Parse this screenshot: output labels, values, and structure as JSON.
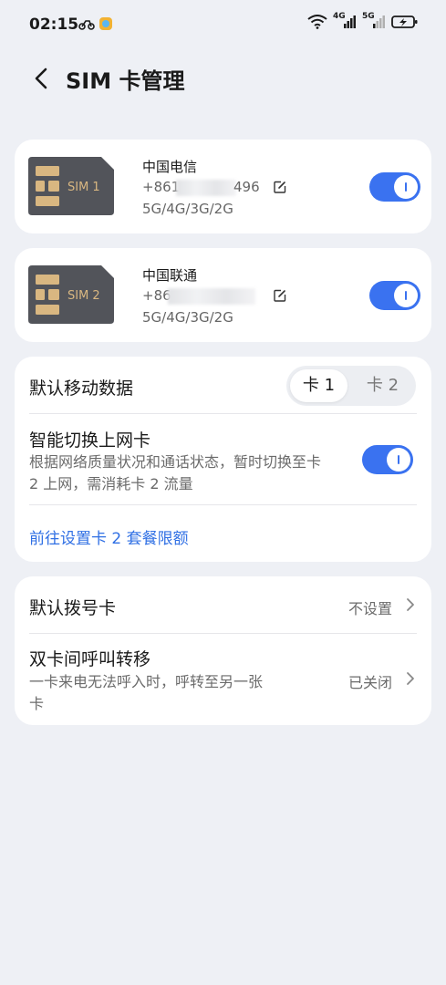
{
  "status_bar": {
    "time": "02:15",
    "net_1": "4G",
    "net_2": "5G"
  },
  "header": {
    "title": "SIM 卡管理"
  },
  "sims": [
    {
      "chip_label": "SIM 1",
      "carrier": "中国电信",
      "number_prefix": "+861",
      "number_suffix": "496",
      "network": "5G/4G/3G/2G",
      "enabled": true
    },
    {
      "chip_label": "SIM 2",
      "carrier": "中国联通",
      "number_prefix": "+86",
      "number_suffix": "",
      "network": "5G/4G/3G/2G",
      "enabled": true
    }
  ],
  "data_card": {
    "default_data_label": "默认移动数据",
    "options": [
      "卡 1",
      "卡 2"
    ],
    "selected": "卡 1",
    "smart_switch_title": "智能切换上网卡",
    "smart_switch_desc": "根据网络质量状况和通话状态，暂时切换至卡 2 上网，需消耗卡 2 流量",
    "smart_switch_enabled": true,
    "link_text": "前往设置卡 2 套餐限额"
  },
  "call_card": {
    "default_dial_label": "默认拨号卡",
    "default_dial_value": "不设置",
    "forward_title": "双卡间呼叫转移",
    "forward_desc": "一卡来电无法呼入时，呼转至另一张卡",
    "forward_value": "已关闭"
  },
  "colors": {
    "accent": "#3a72f0",
    "link": "#2f6fe4",
    "background": "#eef0f5"
  }
}
